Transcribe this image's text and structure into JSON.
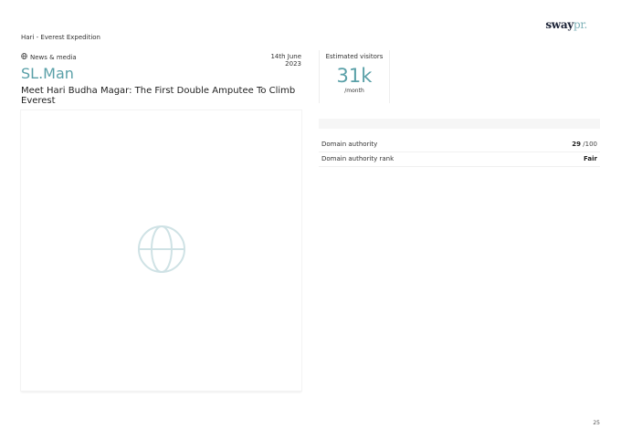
{
  "brand": {
    "part1": "sway",
    "part2": "pr."
  },
  "breadcrumb": "Hari - Everest Expedition",
  "article": {
    "category": "News & media",
    "category_icon": "globe-icon",
    "date": "14th June 2023",
    "outlet": "SL.Man",
    "headline": "Meet Hari Budha Magar: The First Double Amputee To Climb Everest",
    "image_placeholder_icon": "globe-icon"
  },
  "visitors": {
    "label": "Estimated visitors",
    "value": "31k",
    "unit": "/month"
  },
  "metrics": [
    {
      "label": "Domain authority",
      "value": "29",
      "suffix": " /100"
    },
    {
      "label": "Domain authority rank",
      "value": "Fair",
      "suffix": ""
    }
  ],
  "page_number": "25",
  "colors": {
    "accent": "#5aa0a8",
    "brand_dark": "#1b2236",
    "brand_light": "#7fb2b8"
  }
}
